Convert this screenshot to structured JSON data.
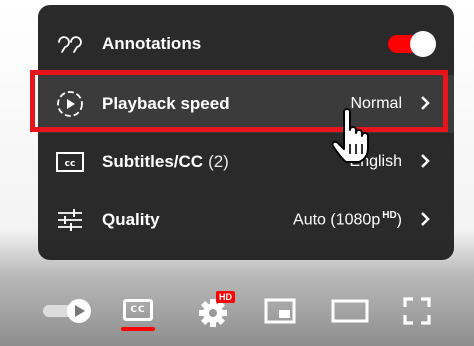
{
  "settings_menu": {
    "items": [
      {
        "label": "Annotations",
        "icon": "annotations-icon",
        "toggle_on": true
      },
      {
        "label": "Playback speed",
        "icon": "playback-speed-icon",
        "value": "Normal"
      },
      {
        "label": "Subtitles/CC",
        "count": "(2)",
        "icon": "subtitles-icon",
        "value": "English"
      },
      {
        "label": "Quality",
        "icon": "quality-sliders-icon",
        "value": "Auto (1080p",
        "value_sup": "HD",
        "value_end": ")"
      }
    ]
  },
  "player_controls": {
    "buttons": [
      "autoplay-toggle-icon",
      "subtitles-cc-icon",
      "settings-gear-icon",
      "miniplayer-icon",
      "theater-mode-icon",
      "fullscreen-icon"
    ],
    "cc_text": "CC",
    "hd_badge": "HD"
  },
  "colors": {
    "accent": "#ff0000",
    "menu_bg": "#212121",
    "highlight_border": "#e8141b"
  }
}
